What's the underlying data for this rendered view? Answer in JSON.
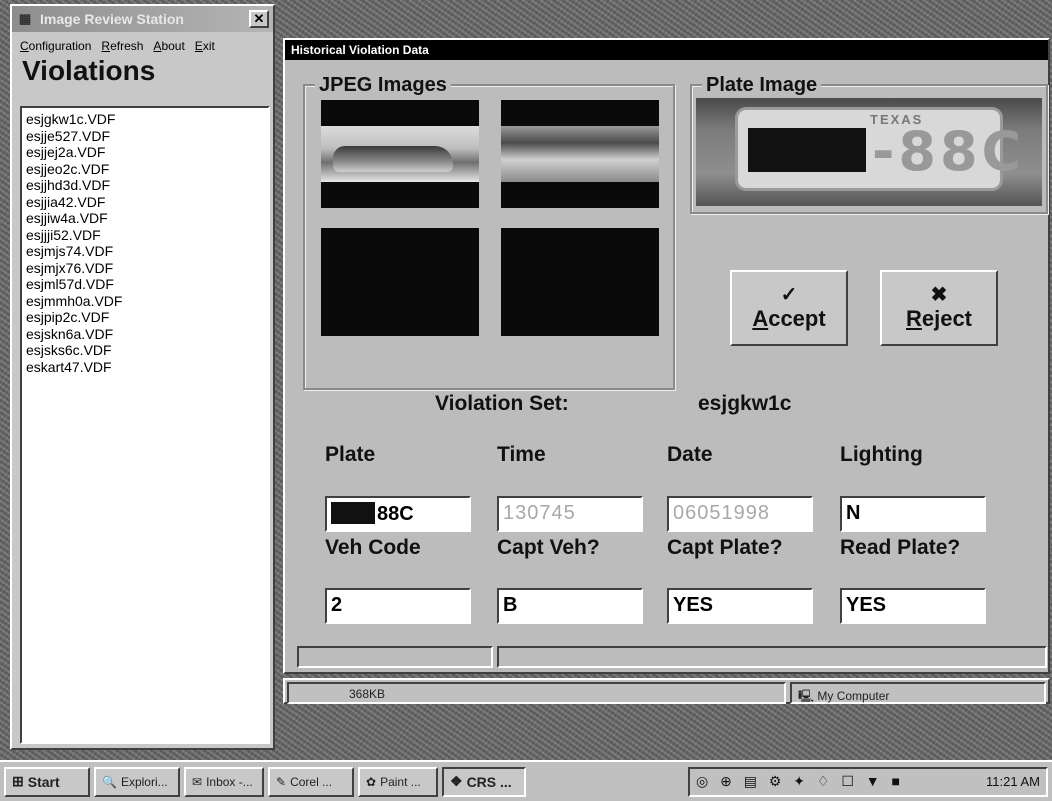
{
  "left_window": {
    "title": "Image Review Station",
    "close_glyph": "✕",
    "menu": [
      "Configuration",
      "Refresh",
      "About",
      "Exit"
    ],
    "heading": "Violations",
    "files": [
      "esjgkw1c.VDF",
      "esjje527.VDF",
      "esjjej2a.VDF",
      "esjjeo2c.VDF",
      "esjjhd3d.VDF",
      "esjjia42.VDF",
      "esjjiw4a.VDF",
      "esjjji52.VDF",
      "esjmjs74.VDF",
      "esjmjx76.VDF",
      "esjml57d.VDF",
      "esjmmh0a.VDF",
      "esjpip2c.VDF",
      "esjskn6a.VDF",
      "esjsks6c.VDF",
      "eskart47.VDF"
    ]
  },
  "main_window": {
    "title": "Historical Violation Data",
    "jpeg_group_label": "JPEG Images",
    "plate_group_label": "Plate Image",
    "plate_image": {
      "state_text": "TEXAS",
      "visible_chars": "-88C"
    },
    "accept": {
      "glyph": "✓",
      "label": "Accept"
    },
    "reject": {
      "glyph": "✖",
      "label": "Reject"
    },
    "violation_set_label": "Violation Set:",
    "violation_set_value": "esjgkw1c",
    "row1_labels": {
      "plate": "Plate",
      "time": "Time",
      "date": "Date",
      "lighting": "Lighting"
    },
    "row1_values": {
      "plate": "88C",
      "time": "130745",
      "date": "06051998",
      "lighting": "N"
    },
    "row2_labels": {
      "veh_code": "Veh Code",
      "capt_veh": "Capt Veh?",
      "capt_plate": "Capt Plate?",
      "read_plate": "Read Plate?"
    },
    "row2_values": {
      "veh_code": "2",
      "capt_veh": "B",
      "capt_plate": "YES",
      "read_plate": "YES"
    }
  },
  "back_status": {
    "size": "368KB",
    "location": "My Computer"
  },
  "taskbar": {
    "start": "Start",
    "buttons": [
      "Explori...",
      "Inbox -...",
      "Corel ...",
      "Paint ...",
      "CRS ..."
    ],
    "clock": "11:21 AM"
  },
  "icons": {
    "window": "app-window-icon",
    "close": "close-icon",
    "start": "windows-logo-icon",
    "check": "checkmark-icon",
    "reject": "x-icon",
    "computer": "computer-icon"
  }
}
